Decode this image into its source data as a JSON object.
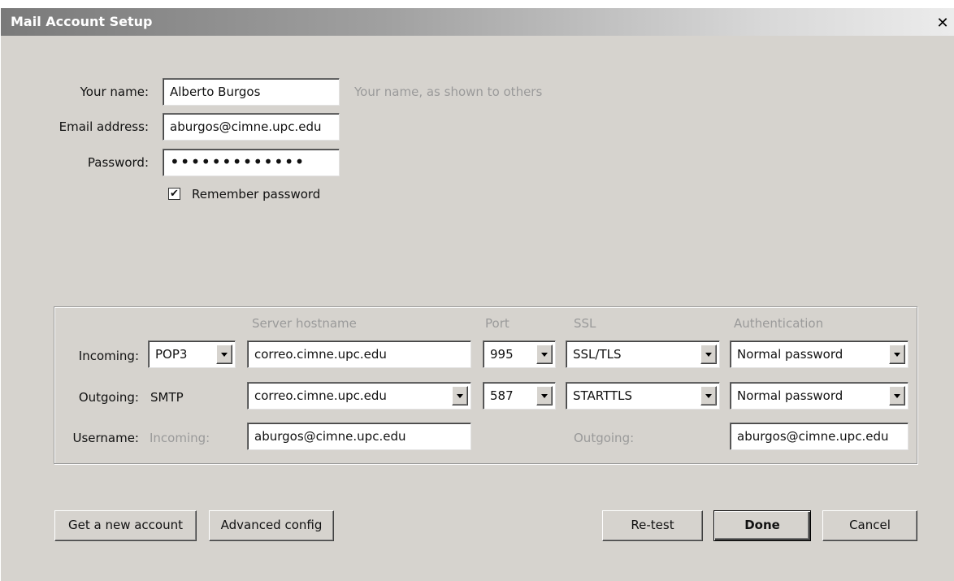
{
  "window": {
    "title": "Mail Account Setup",
    "close": "✕"
  },
  "identity": {
    "name_label": "Your name:",
    "name_value": "Alberto Burgos",
    "name_hint": "Your name, as shown to others",
    "email_label": "Email address:",
    "email_value": "aburgos@cimne.upc.edu",
    "password_label": "Password:",
    "password_value": "•••••••••••••",
    "remember_label": "Remember password",
    "remember_checked": true
  },
  "servers": {
    "col_hostname": "Server hostname",
    "col_port": "Port",
    "col_ssl": "SSL",
    "col_auth": "Authentication",
    "incoming": {
      "label": "Incoming:",
      "protocol": "POP3",
      "hostname": "correo.cimne.upc.edu",
      "port": "995",
      "ssl": "SSL/TLS",
      "auth": "Normal password"
    },
    "outgoing": {
      "label": "Outgoing:",
      "protocol": "SMTP",
      "hostname": "correo.cimne.upc.edu",
      "port": "587",
      "ssl": "STARTTLS",
      "auth": "Normal password"
    },
    "username": {
      "label": "Username:",
      "incoming_label": "Incoming:",
      "incoming_value": "aburgos@cimne.upc.edu",
      "outgoing_label": "Outgoing:",
      "outgoing_value": "aburgos@cimne.upc.edu"
    }
  },
  "buttons": {
    "get_account": "Get a new account",
    "advanced": "Advanced config",
    "retest": "Re-test",
    "done": "Done",
    "cancel": "Cancel"
  }
}
